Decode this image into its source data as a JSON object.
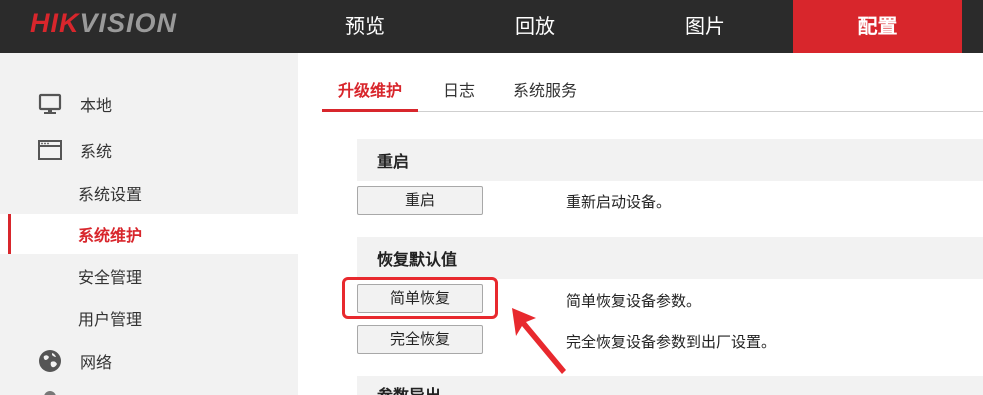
{
  "brand": {
    "part1": "HIK",
    "part2": "VISION",
    "accent": "#d8262c"
  },
  "nav": {
    "items": [
      {
        "label": "预览"
      },
      {
        "label": "回放"
      },
      {
        "label": "图片"
      },
      {
        "label": "配置",
        "active": true
      }
    ]
  },
  "sidebar": {
    "items": [
      {
        "label": "本地",
        "icon": "monitor-icon"
      },
      {
        "label": "系统",
        "icon": "system-window-icon"
      },
      {
        "label": "系统设置"
      },
      {
        "label": "系统维护",
        "active": true
      },
      {
        "label": "安全管理"
      },
      {
        "label": "用户管理"
      },
      {
        "label": "网络",
        "icon": "globe-icon"
      }
    ]
  },
  "tabs": [
    {
      "label": "升级维护",
      "active": true
    },
    {
      "label": "日志"
    },
    {
      "label": "系统服务"
    }
  ],
  "sections": {
    "reboot": {
      "title": "重启",
      "button_label": "重启",
      "description": "重新启动设备。"
    },
    "restore": {
      "title": "恢复默认值",
      "simple_button_label": "简单恢复",
      "simple_description": "简单恢复设备参数。",
      "full_button_label": "完全恢复",
      "full_description": "完全恢复设备参数到出厂设置。"
    },
    "export": {
      "title": "参数导出"
    }
  },
  "annotation": {
    "color": "#e8292e",
    "icon": "red-arrow-icon"
  }
}
